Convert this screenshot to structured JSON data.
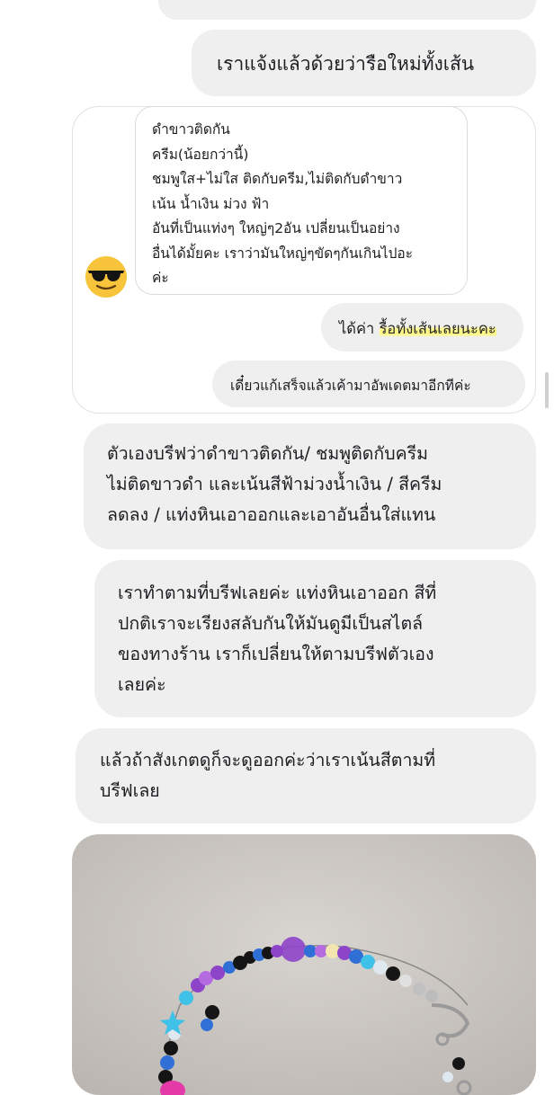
{
  "messages": {
    "msg1": "เราแจ้งแล้วด้วยว่ารือใหม่ทั้งเส้น",
    "quoted": "ดำขาวติดกัน\nครีม(น้อยกว่านี้)\nชมพูใส+ไม่ใส ติดกับครีม,ไม่ติดกับดำขาว\nเน้น น้ำเงิน ม่วง ฟ้า\nอันที่เป็นแท่งๆ ใหญ่ๆ2อัน เปลี่ยนเป็นอย่าง\nอื่นได้มั้ยคะ เราว่ามันใหญ่ๆขัดๆกันเกินไปอะ\nค่ะ",
    "reply1_prefix": "ได้ค่า ",
    "reply1_highlight": "รื้อทั้งเส้นเลยนะคะ",
    "reply2": "เดี๋ยวแก้เสร็จแล้วเค้ามาอัพเดตมาอีกทีค่ะ",
    "msg2": "ตัวเองบรีฟว่าดำขาวติดกัน/ ชมพูติดกับครีม\nไม่ติดขาวดำ และเน้นสีฟ้าม่วงน้ำเงิน / สีครีม\nลดลง / แท่งหินเอาออกและเอาอันอื่นใส่แทน",
    "msg3": "เราทำตามที่บรีฟเลยค่ะ แท่งหินเอาออก สีที่\nปกติเราจะเรียงสลับกันให้มันดูมีเป็นสไตล์\nของทางร้าน เราก็เปลี่ยนให้ตามบรีฟตัวเอง\nเลยค่ะ",
    "msg4": "แล้วถ้าสังเกตดูก็จะดูออกค่ะว่าเราเน้นสีตามที่\nบรีฟเลย"
  },
  "icons": {
    "emoji": "sunglasses-face-icon"
  },
  "colors": {
    "bubble": "#efefef",
    "highlight": "#fff882",
    "emoji_yellow": "#f7c43b",
    "bead_purple": "#8e44c9",
    "bead_blue": "#2f6fd6",
    "bead_black": "#151515",
    "bead_cyan": "#3fc1e8",
    "bead_cream": "#f3e6b0",
    "bead_pink": "#e43aa8"
  }
}
